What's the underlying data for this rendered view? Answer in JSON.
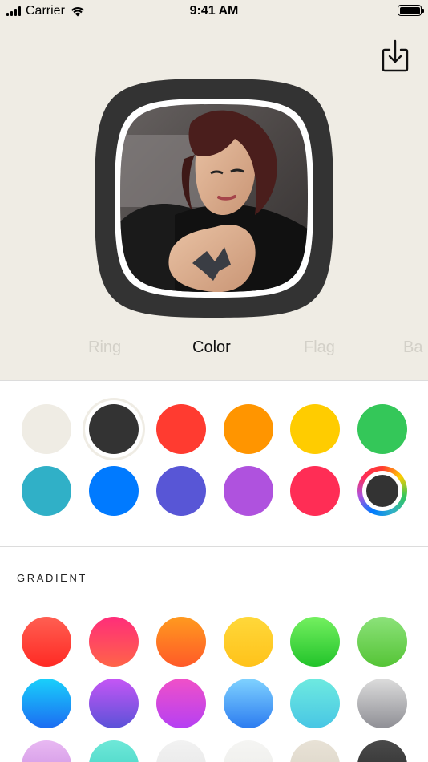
{
  "status_bar": {
    "carrier": "Carrier",
    "time": "9:41 AM"
  },
  "preview": {
    "ring_color": "#333333",
    "inner_border_color": "#ffffff",
    "photo_description_icon": "portrait-photo"
  },
  "mode_tabs": [
    {
      "label": "Ring",
      "active": false
    },
    {
      "label": "Color",
      "active": true
    },
    {
      "label": "Flag",
      "active": false
    },
    {
      "label": "Ba",
      "active": false
    }
  ],
  "solid_colors": [
    {
      "name": "cream",
      "hex": "#efece4"
    },
    {
      "name": "dark-gray",
      "hex": "#333333",
      "selected": true
    },
    {
      "name": "red",
      "hex": "#ff3b30"
    },
    {
      "name": "orange",
      "hex": "#ff9500"
    },
    {
      "name": "yellow",
      "hex": "#ffcc00"
    },
    {
      "name": "green",
      "hex": "#34c759"
    },
    {
      "name": "teal",
      "hex": "#30b0c7"
    },
    {
      "name": "blue",
      "hex": "#007aff"
    },
    {
      "name": "indigo",
      "hex": "#5856d6"
    },
    {
      "name": "purple",
      "hex": "#af52de"
    },
    {
      "name": "pink",
      "hex": "#ff2d55"
    },
    {
      "name": "custom-color-picker",
      "hex": "#333333"
    }
  ],
  "gradient_section": {
    "title": "GRADIENT"
  },
  "gradients": [
    {
      "name": "red",
      "from": "#ff5f52",
      "to": "#ff2a24"
    },
    {
      "name": "pink-red",
      "from": "#ff2d7a",
      "to": "#ff6448"
    },
    {
      "name": "orange",
      "from": "#ff9a1f",
      "to": "#ff5a28"
    },
    {
      "name": "yellow",
      "from": "#ffd83a",
      "to": "#ffc21a"
    },
    {
      "name": "green",
      "from": "#74f060",
      "to": "#22c32a"
    },
    {
      "name": "light-green",
      "from": "#8ce27a",
      "to": "#55c436"
    },
    {
      "name": "cyan-blue",
      "from": "#1ad0fb",
      "to": "#1b6cf2"
    },
    {
      "name": "violet",
      "from": "#c556f5",
      "to": "#5b52d8"
    },
    {
      "name": "magenta",
      "from": "#f050c8",
      "to": "#b540f3"
    },
    {
      "name": "sky-blue",
      "from": "#7fd2ff",
      "to": "#2c7cf0"
    },
    {
      "name": "aqua",
      "from": "#6eeae0",
      "to": "#48c6e4"
    },
    {
      "name": "silver",
      "from": "#dcdcdc",
      "to": "#8f8f95"
    },
    {
      "name": "lavender",
      "from": "#e8b8f2",
      "to": "#c98ae0"
    },
    {
      "name": "mint",
      "from": "#6ee8d8",
      "to": "#3ccfc0"
    },
    {
      "name": "light-gray",
      "from": "#f2f2f2",
      "to": "#e4e4e4"
    },
    {
      "name": "off-white",
      "from": "#f5f5f3",
      "to": "#ebebe8"
    },
    {
      "name": "beige",
      "from": "#e8e2d6",
      "to": "#d9d2c4"
    },
    {
      "name": "charcoal",
      "from": "#4a4a4a",
      "to": "#2a2a2a"
    }
  ]
}
